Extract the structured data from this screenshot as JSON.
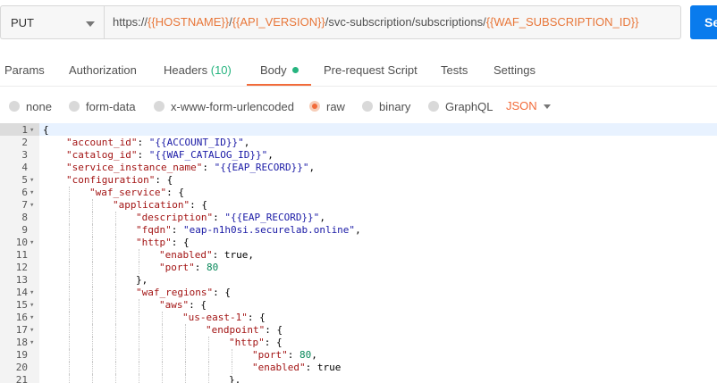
{
  "request": {
    "method": "PUT",
    "url_parts": [
      {
        "text": "https://",
        "type": "plain"
      },
      {
        "text": "{{HOSTNAME}}",
        "type": "var"
      },
      {
        "text": "/",
        "type": "plain"
      },
      {
        "text": "{{API_VERSION}}",
        "type": "var"
      },
      {
        "text": "/svc-subscription/subscriptions/",
        "type": "plain"
      },
      {
        "text": "{{WAF_SUBSCRIPTION_ID}}",
        "type": "var"
      }
    ],
    "send_label": "Se"
  },
  "tabs": [
    {
      "label": "Params",
      "count": ""
    },
    {
      "label": "Authorization",
      "count": ""
    },
    {
      "label": "Headers",
      "count": "(10)"
    },
    {
      "label": "Body",
      "count": ""
    },
    {
      "label": "Pre-request Script",
      "count": ""
    },
    {
      "label": "Tests",
      "count": ""
    },
    {
      "label": "Settings",
      "count": ""
    }
  ],
  "active_tab": "Body",
  "body_types": [
    {
      "label": "none",
      "checked": false
    },
    {
      "label": "form-data",
      "checked": false
    },
    {
      "label": "x-www-form-urlencoded",
      "checked": false
    },
    {
      "label": "raw",
      "checked": true
    },
    {
      "label": "binary",
      "checked": false
    },
    {
      "label": "GraphQL",
      "checked": false
    }
  ],
  "format": "JSON",
  "colors": {
    "accent": "#f26b3a",
    "send": "#097bed",
    "variable": "#e8773a",
    "count": "#26b47f"
  },
  "editor_lines": [
    {
      "n": "1",
      "fold": true,
      "indent": 0,
      "tokens": [
        {
          "t": "{",
          "c": "p"
        }
      ]
    },
    {
      "n": "2",
      "fold": false,
      "indent": 1,
      "tokens": [
        {
          "t": "\"account_id\"",
          "c": "k"
        },
        {
          "t": ": ",
          "c": "p"
        },
        {
          "t": "\"{{ACCOUNT_ID}}\"",
          "c": "s"
        },
        {
          "t": ",",
          "c": "p"
        }
      ]
    },
    {
      "n": "3",
      "fold": false,
      "indent": 1,
      "tokens": [
        {
          "t": "\"catalog_id\"",
          "c": "k"
        },
        {
          "t": ": ",
          "c": "p"
        },
        {
          "t": "\"{{WAF_CATALOG_ID}}\"",
          "c": "s"
        },
        {
          "t": ",",
          "c": "p"
        }
      ]
    },
    {
      "n": "4",
      "fold": false,
      "indent": 1,
      "tokens": [
        {
          "t": "\"service_instance_name\"",
          "c": "k"
        },
        {
          "t": ": ",
          "c": "p"
        },
        {
          "t": "\"{{EAP_RECORD}}\"",
          "c": "s"
        },
        {
          "t": ",",
          "c": "p"
        }
      ]
    },
    {
      "n": "5",
      "fold": true,
      "indent": 1,
      "tokens": [
        {
          "t": "\"configuration\"",
          "c": "k"
        },
        {
          "t": ": {",
          "c": "p"
        }
      ]
    },
    {
      "n": "6",
      "fold": true,
      "indent": 2,
      "tokens": [
        {
          "t": "\"waf_service\"",
          "c": "k"
        },
        {
          "t": ": {",
          "c": "p"
        }
      ]
    },
    {
      "n": "7",
      "fold": true,
      "indent": 3,
      "tokens": [
        {
          "t": "\"application\"",
          "c": "k"
        },
        {
          "t": ": {",
          "c": "p"
        }
      ]
    },
    {
      "n": "8",
      "fold": false,
      "indent": 4,
      "tokens": [
        {
          "t": "\"description\"",
          "c": "k"
        },
        {
          "t": ": ",
          "c": "p"
        },
        {
          "t": "\"{{EAP_RECORD}}\"",
          "c": "s"
        },
        {
          "t": ",",
          "c": "p"
        }
      ]
    },
    {
      "n": "9",
      "fold": false,
      "indent": 4,
      "tokens": [
        {
          "t": "\"fqdn\"",
          "c": "k"
        },
        {
          "t": ": ",
          "c": "p"
        },
        {
          "t": "\"eap-n1h0si.securelab.online\"",
          "c": "s"
        },
        {
          "t": ",",
          "c": "p"
        }
      ]
    },
    {
      "n": "10",
      "fold": true,
      "indent": 4,
      "tokens": [
        {
          "t": "\"http\"",
          "c": "k"
        },
        {
          "t": ": {",
          "c": "p"
        }
      ]
    },
    {
      "n": "11",
      "fold": false,
      "indent": 5,
      "tokens": [
        {
          "t": "\"enabled\"",
          "c": "k"
        },
        {
          "t": ": true,",
          "c": "p"
        }
      ]
    },
    {
      "n": "12",
      "fold": false,
      "indent": 5,
      "tokens": [
        {
          "t": "\"port\"",
          "c": "k"
        },
        {
          "t": ": ",
          "c": "p"
        },
        {
          "t": "80",
          "c": "n"
        }
      ]
    },
    {
      "n": "13",
      "fold": false,
      "indent": 4,
      "tokens": [
        {
          "t": "},",
          "c": "p"
        }
      ]
    },
    {
      "n": "14",
      "fold": true,
      "indent": 4,
      "tokens": [
        {
          "t": "\"waf_regions\"",
          "c": "k"
        },
        {
          "t": ": {",
          "c": "p"
        }
      ]
    },
    {
      "n": "15",
      "fold": true,
      "indent": 5,
      "tokens": [
        {
          "t": "\"aws\"",
          "c": "k"
        },
        {
          "t": ": {",
          "c": "p"
        }
      ]
    },
    {
      "n": "16",
      "fold": true,
      "indent": 6,
      "tokens": [
        {
          "t": "\"us-east-1\"",
          "c": "k"
        },
        {
          "t": ": {",
          "c": "p"
        }
      ]
    },
    {
      "n": "17",
      "fold": true,
      "indent": 7,
      "tokens": [
        {
          "t": "\"endpoint\"",
          "c": "k"
        },
        {
          "t": ": {",
          "c": "p"
        }
      ]
    },
    {
      "n": "18",
      "fold": true,
      "indent": 8,
      "tokens": [
        {
          "t": "\"http\"",
          "c": "k"
        },
        {
          "t": ": {",
          "c": "p"
        }
      ]
    },
    {
      "n": "19",
      "fold": false,
      "indent": 9,
      "tokens": [
        {
          "t": "\"port\"",
          "c": "k"
        },
        {
          "t": ": ",
          "c": "p"
        },
        {
          "t": "80",
          "c": "n"
        },
        {
          "t": ",",
          "c": "p"
        }
      ]
    },
    {
      "n": "20",
      "fold": false,
      "indent": 9,
      "tokens": [
        {
          "t": "\"enabled\"",
          "c": "k"
        },
        {
          "t": ": true",
          "c": "p"
        }
      ]
    },
    {
      "n": "21",
      "fold": false,
      "indent": 8,
      "tokens": [
        {
          "t": "},",
          "c": "p"
        }
      ]
    }
  ]
}
